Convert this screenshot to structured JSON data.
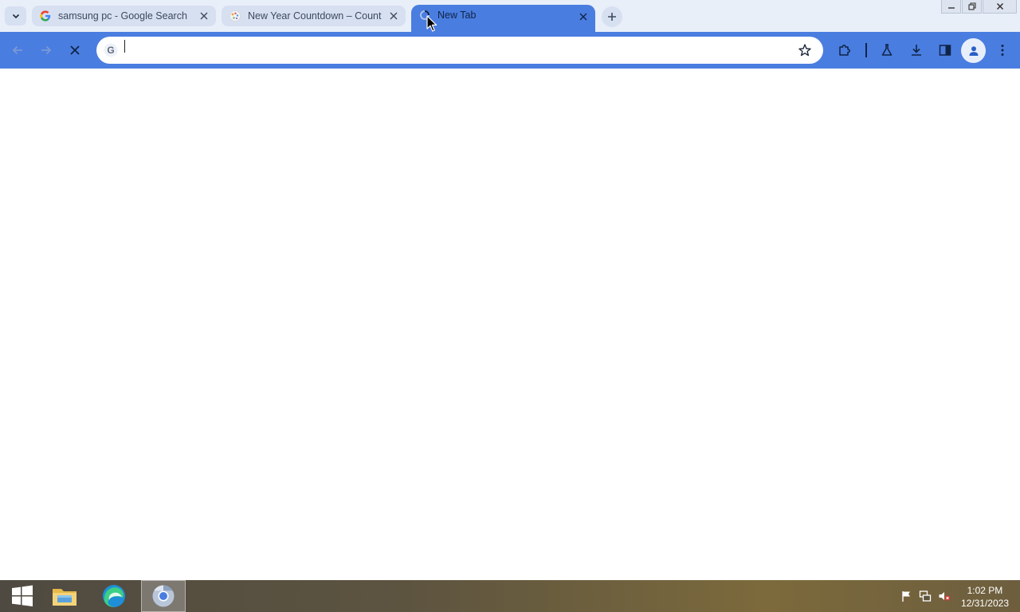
{
  "browser": {
    "tabs": [
      {
        "title": "samsung pc - Google Search",
        "favicon": "google-g-icon",
        "active": false
      },
      {
        "title": "New Year Countdown – Countdown",
        "favicon": "countdown-favicon-icon",
        "active": false
      },
      {
        "title": "New Tab",
        "favicon": "loading-spinner-icon",
        "active": true
      }
    ],
    "omnibox": {
      "value": "",
      "placeholder": ""
    },
    "accent_color": "#4a7de0"
  },
  "taskbar": {
    "apps": [
      {
        "name": "start-button"
      },
      {
        "name": "file-explorer"
      },
      {
        "name": "microsoft-edge"
      },
      {
        "name": "google-chrome",
        "active": true
      }
    ],
    "clock": {
      "time": "1:02 PM",
      "date": "12/31/2023"
    }
  }
}
